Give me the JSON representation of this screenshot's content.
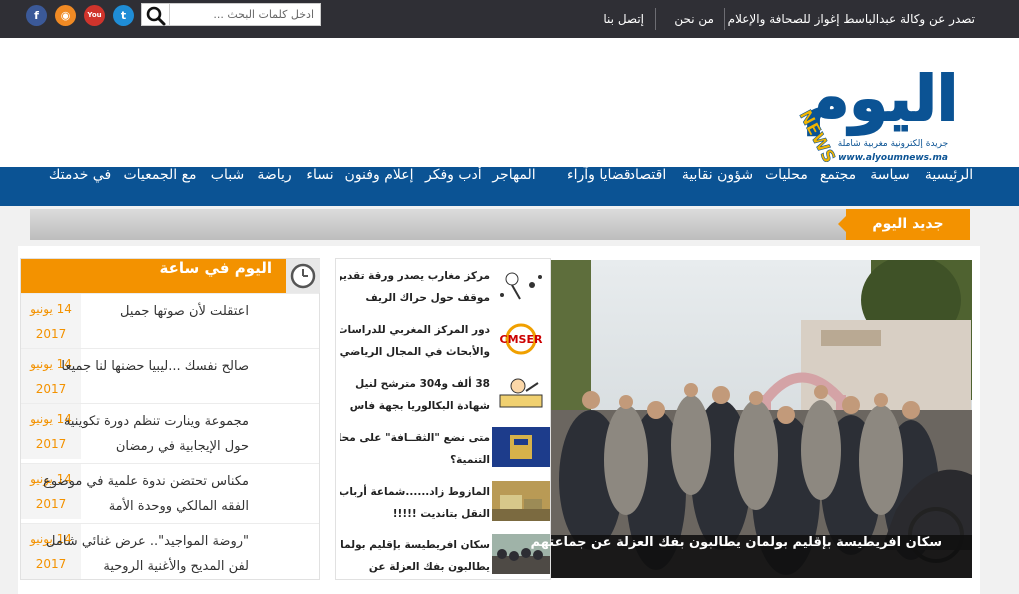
{
  "topbar": {
    "agency_text": "تصدر عن وكالة عبدالباسط إغواز للصحافة والإعلام",
    "about_label": "من نحن",
    "contact_label": "إتصل بنا",
    "search_placeholder": "ادخل كلمات البحث ...",
    "social": [
      {
        "name": "twitter",
        "glyph": "t",
        "color": "#1f8dd6"
      },
      {
        "name": "youtube",
        "glyph": "You",
        "color": "#d0342c"
      },
      {
        "name": "rss",
        "glyph": "◉",
        "color": "#f08a24"
      },
      {
        "name": "facebook",
        "glyph": "f",
        "color": "#3b5998"
      }
    ]
  },
  "logo": {
    "title": "اليوم",
    "news": "NEWS",
    "tagline": "جريدة إلكترونية مغربية شاملة",
    "url": "www.alyoumnews.ma",
    "colors": {
      "primary": "#0b5394",
      "accent": "#f0b400"
    }
  },
  "nav": {
    "items": [
      "الرئيسية",
      "سياسة",
      "مجتمع",
      "محليات",
      "شؤون نقابية",
      "اقتصاد",
      "قضايا وآراء",
      "المهاجر",
      "أدب وفكر",
      "إعلام وفنون",
      "نساء",
      "رياضة",
      "شباب",
      "مع الجمعيات",
      "في خدمتك"
    ]
  },
  "ticker": {
    "label": "جديد اليوم"
  },
  "sidebar": {
    "title": "اليوم في ساعة",
    "items": [
      {
        "day": "14 يونيو",
        "year": "2017",
        "text_lines": [
          "اعتقلت لأن صوتها جميل"
        ]
      },
      {
        "day": "14 يونيو",
        "year": "2017",
        "text_lines": [
          "صالح نفسك ...ليبيا حضنها لنا جميعا"
        ]
      },
      {
        "day": "14 يونيو",
        "year": "2017",
        "text_lines": [
          "مجموعة وينارت تنظم دورة تكوينية",
          "حول الإيجابية في رمضان"
        ]
      },
      {
        "day": "14 يونيو",
        "year": "2017",
        "text_lines": [
          "مكناس تحتضن ندوة علمية في موضوع",
          "الفقه المالكي ووحدة الأمة"
        ]
      },
      {
        "day": "14 يونيو",
        "year": "2017",
        "text_lines": [
          "\"روضة المواجيد\".. عرض غنائي شامل",
          "لفن المديح والأغنية الروحية"
        ]
      }
    ]
  },
  "mid": {
    "items": [
      {
        "thumb": "cartoon",
        "lines": [
          "مركز مغارب يصدر ورقة تقدير",
          "موقف حول حراك الريف"
        ]
      },
      {
        "thumb": "cmser",
        "thumb_label": "CMSER",
        "lines": [
          "دور المركز المغربي للدراسات",
          "والأبحاث في المجال الرياضي"
        ]
      },
      {
        "thumb": "exam",
        "lines": [
          "38 ألف و304 مترشح لنيل",
          "شهادة البكالوريا بجهة فاس"
        ]
      },
      {
        "thumb": "thaqafa",
        "lines": [
          "متى نضع \"الثقــافة\" على محك",
          "التنمية؟"
        ]
      },
      {
        "thumb": "trucks",
        "lines": [
          "المازوط زاد......شماعة أرباب",
          "النقل بتانديت !!!!!"
        ]
      },
      {
        "thumb": "crowd",
        "lines": [
          "سكان افريطيسة بإقليم بولمان",
          "يطالبون بفك العزلة عن"
        ]
      }
    ]
  },
  "featured": {
    "caption": "سكان افريطيسة بإقليم بولمان يطالبون بفك العزلة عن جماعتهم"
  }
}
